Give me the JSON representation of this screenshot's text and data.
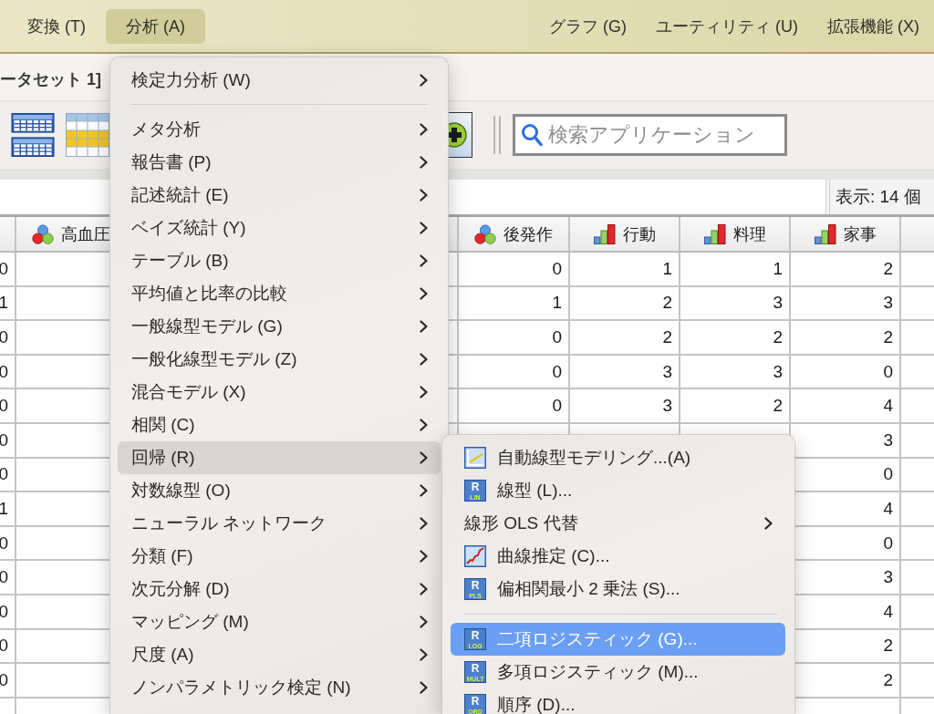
{
  "menu_bar": {
    "left_items": [
      {
        "label": "変換 (T)",
        "selected": false
      },
      {
        "label": "分析 (A)",
        "selected": true
      }
    ],
    "right_items": [
      {
        "label": "グラフ (G)",
        "selected": false
      },
      {
        "label": "ユーティリティ (U)",
        "selected": false
      },
      {
        "label": "拡張機能 (X)",
        "selected": false
      }
    ]
  },
  "window": {
    "title": "ータセット 1]"
  },
  "toolbar": {
    "search": {
      "placeholder": "検索アプリケーション"
    }
  },
  "status": {
    "variables_shown": "表示: 14 個"
  },
  "table": {
    "columns": [
      {
        "cells": [
          "0",
          "1",
          "0",
          "0",
          "0",
          "0",
          "0",
          "1",
          "0",
          "0",
          "0",
          "0",
          "0"
        ]
      },
      {
        "label": "高血圧",
        "kind": "nominal"
      },
      {
        "label": "後発作",
        "kind": "nominal",
        "cells": [
          "0",
          "1",
          "0",
          "0",
          "0"
        ]
      },
      {
        "label": "行動",
        "kind": "ordinal",
        "cells": [
          "1",
          "2",
          "2",
          "3",
          "3"
        ]
      },
      {
        "label": "料理",
        "kind": "ordinal",
        "cells": [
          "1",
          "3",
          "2",
          "3",
          "2"
        ]
      },
      {
        "label": "家事",
        "kind": "ordinal",
        "cells": [
          "2",
          "3",
          "2",
          "0",
          "4",
          "3",
          "0",
          "4",
          "0",
          "3",
          "4",
          "2",
          "2"
        ]
      }
    ]
  },
  "analyze_menu": {
    "items": [
      {
        "kind": "item",
        "label": "検定力分析 (W)",
        "submenu": true,
        "selected": false
      },
      {
        "kind": "separator"
      },
      {
        "kind": "item",
        "label": "メタ分析",
        "submenu": true,
        "selected": false
      },
      {
        "kind": "item",
        "label": "報告書 (P)",
        "submenu": true,
        "selected": false
      },
      {
        "kind": "item",
        "label": "記述統計 (E)",
        "submenu": true,
        "selected": false
      },
      {
        "kind": "item",
        "label": "ベイズ統計 (Y)",
        "submenu": true,
        "selected": false
      },
      {
        "kind": "item",
        "label": "テーブル (B)",
        "submenu": true,
        "selected": false
      },
      {
        "kind": "item",
        "label": "平均値と比率の比較",
        "submenu": true,
        "selected": false
      },
      {
        "kind": "item",
        "label": "一般線型モデル (G)",
        "submenu": true,
        "selected": false
      },
      {
        "kind": "item",
        "label": "一般化線型モデル (Z)",
        "submenu": true,
        "selected": false
      },
      {
        "kind": "item",
        "label": "混合モデル (X)",
        "submenu": true,
        "selected": false
      },
      {
        "kind": "item",
        "label": "相関 (C)",
        "submenu": true,
        "selected": false
      },
      {
        "kind": "item",
        "label": "回帰 (R)",
        "submenu": true,
        "selected": true
      },
      {
        "kind": "item",
        "label": "対数線型 (O)",
        "submenu": true,
        "selected": false
      },
      {
        "kind": "item",
        "label": "ニューラル ネットワーク",
        "submenu": true,
        "selected": false
      },
      {
        "kind": "item",
        "label": "分類 (F)",
        "submenu": true,
        "selected": false
      },
      {
        "kind": "item",
        "label": "次元分解 (D)",
        "submenu": true,
        "selected": false
      },
      {
        "kind": "item",
        "label": "マッピング (M)",
        "submenu": true,
        "selected": false
      },
      {
        "kind": "item",
        "label": "尺度 (A)",
        "submenu": true,
        "selected": false
      },
      {
        "kind": "item",
        "label": "ノンパラメトリック検定 (N)",
        "submenu": true,
        "selected": false
      }
    ]
  },
  "regression_submenu": {
    "items": [
      {
        "kind": "item",
        "label": "自動線型モデリング...(A)",
        "icon": {
          "kind": "auto-model"
        },
        "submenu": false,
        "selected": false
      },
      {
        "kind": "item",
        "label": "線型 (L)...",
        "icon": {
          "kind": "r-badge",
          "letter": "R",
          "code": "LIN"
        },
        "submenu": false,
        "selected": false
      },
      {
        "kind": "item",
        "label": "線形 OLS 代替",
        "submenu": true,
        "selected": false
      },
      {
        "kind": "item",
        "label": "曲線推定 (C)...",
        "icon": {
          "kind": "curve"
        },
        "submenu": false,
        "selected": false
      },
      {
        "kind": "item",
        "label": "偏相関最小 2 乗法 (S)...",
        "icon": {
          "kind": "r-badge",
          "letter": "R",
          "code": "PLS"
        },
        "submenu": false,
        "selected": false
      },
      {
        "kind": "separator"
      },
      {
        "kind": "item",
        "label": "二項ロジスティック (G)...",
        "icon": {
          "kind": "r-badge",
          "letter": "R",
          "code": "LOG"
        },
        "submenu": false,
        "selected": true
      },
      {
        "kind": "item",
        "label": "多項ロジスティック (M)...",
        "icon": {
          "kind": "r-badge",
          "letter": "R",
          "code": "MULT"
        },
        "submenu": false,
        "selected": false
      },
      {
        "kind": "item",
        "label": "順序 (D)...",
        "icon": {
          "kind": "r-badge",
          "letter": "R",
          "code": "ORD"
        },
        "submenu": false,
        "selected": false
      }
    ]
  }
}
